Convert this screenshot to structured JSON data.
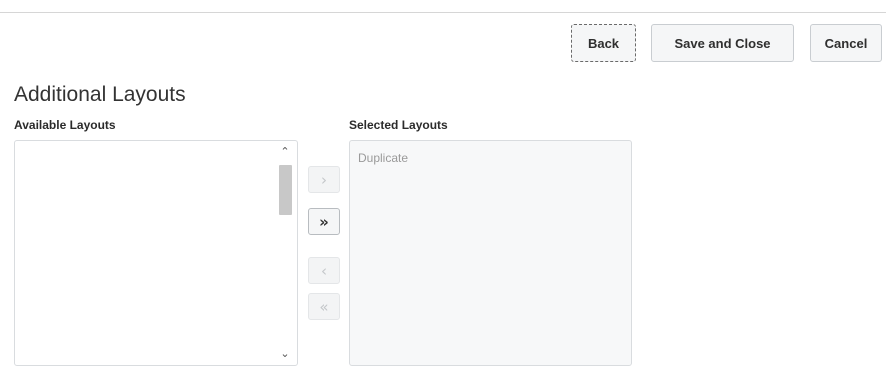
{
  "toolbar": {
    "back_label": "Back",
    "save_close_label": "Save and Close",
    "cancel_label": "Cancel"
  },
  "section": {
    "title": "Additional Layouts"
  },
  "available_list": {
    "label": "Available Layouts",
    "items": []
  },
  "selected_list": {
    "label": "Selected Layouts",
    "items": [
      "Duplicate"
    ]
  },
  "shuttle": {
    "move_right": {
      "icon": "chevron-right-icon",
      "enabled": false
    },
    "move_all_right": {
      "icon": "double-chevron-right-icon",
      "enabled": true
    },
    "move_left": {
      "icon": "chevron-left-icon",
      "enabled": false
    },
    "move_all_left": {
      "icon": "double-chevron-left-icon",
      "enabled": false
    }
  }
}
